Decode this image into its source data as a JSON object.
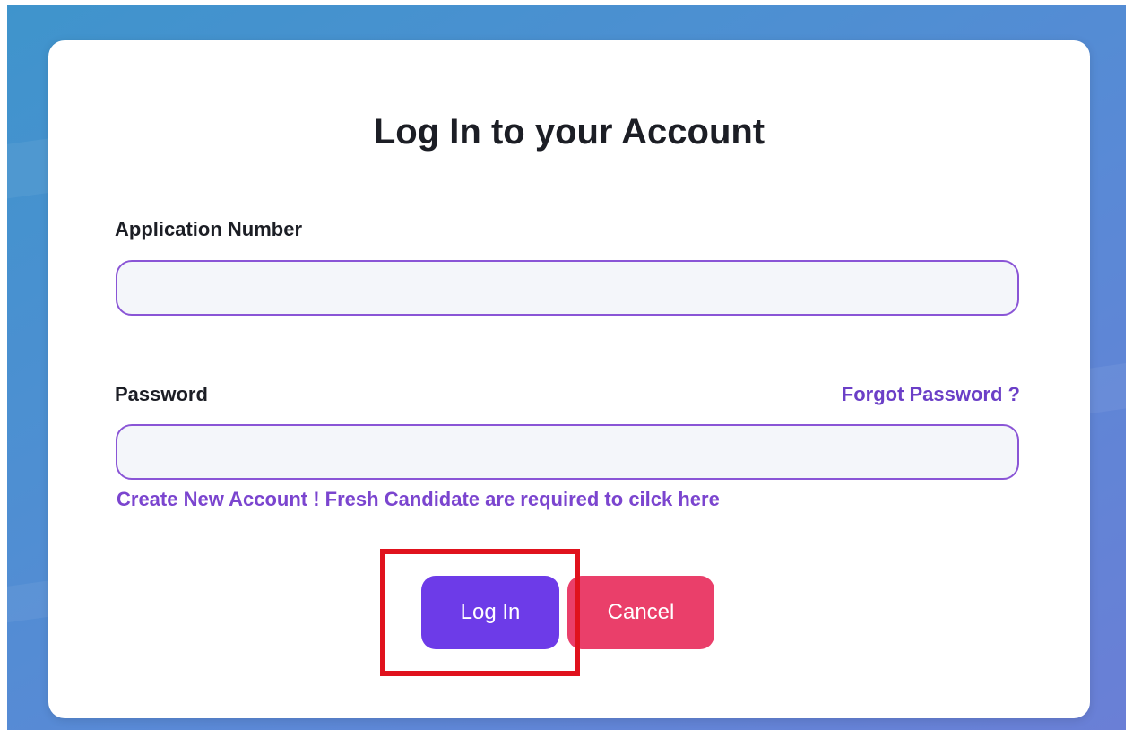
{
  "colors": {
    "background": "#4e8fd2",
    "card": "#ffffff",
    "accent": "#6d3be8",
    "link": "#6b3fc7",
    "cancel": "#ea3f6a",
    "field_border": "#8a55d6",
    "highlight": "#e0121d"
  },
  "login_form": {
    "title": "Log In to your Account",
    "application_number_label": "Application Number",
    "application_number_value": "",
    "password_label": "Password",
    "password_value": "",
    "forgot_password_link": "Forgot Password ?",
    "create_account_link": "Create New Account ! Fresh Candidate are required to cilck here",
    "login_button": "Log In",
    "cancel_button": "Cancel"
  },
  "annotation": {
    "highlighted_element": "login-button"
  }
}
